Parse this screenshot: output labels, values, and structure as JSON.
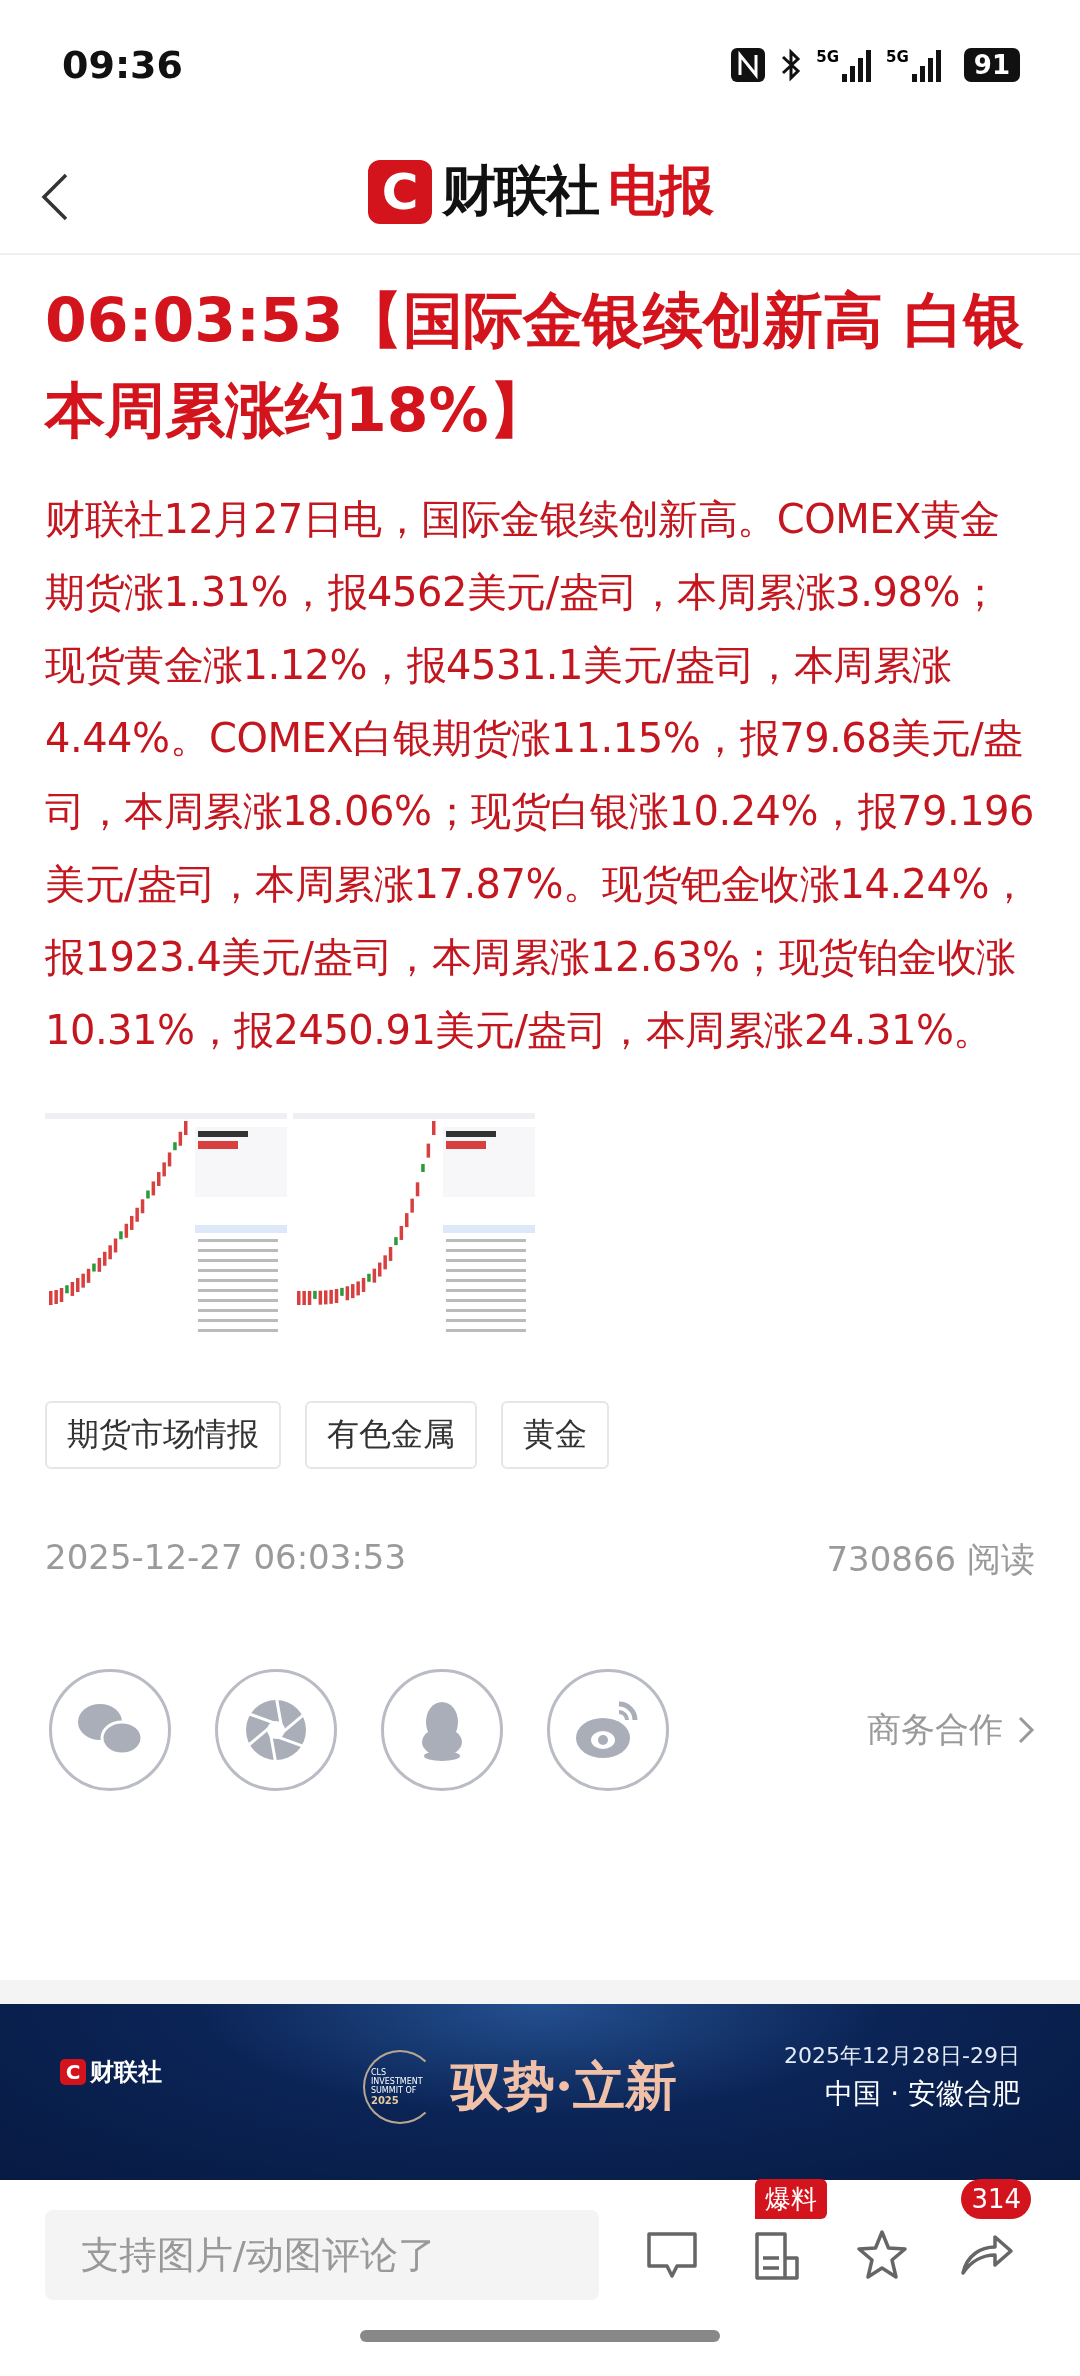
{
  "status_bar": {
    "time": "09:36",
    "networks": [
      "5G",
      "5G"
    ],
    "battery": "91"
  },
  "header": {
    "logo_letter": "C",
    "logo_name": "财联社",
    "logo_accent": "电报"
  },
  "article": {
    "title": "06:03:53【国际金银续创新高 白银本周累涨约18%】",
    "body": "财联社12月27日电，国际金银续创新高。COMEX黄金期货涨1.31%，报4562美元/盎司，本周累涨3.98%；现货黄金涨1.12%，报4531.1美元/盎司，本周累涨4.44%。COMEX白银期货涨11.15%，报79.68美元/盎司，本周累涨18.06%；现货白银涨10.24%，报79.196美元/盎司，本周累涨17.87%。现货钯金收涨14.24%，报1923.4美元/盎司，本周累涨12.63%；现货铂金收涨10.31%，报2450.91美元/盎司，本周累涨24.31%。",
    "images": [
      {
        "kind": "picture"
      },
      {
        "kind": "picture"
      }
    ],
    "tags": [
      "期货市场情报",
      "有色金属",
      "黄金"
    ],
    "timestamp": "2025-12-27 06:03:53",
    "reads": "730866 阅读"
  },
  "share": {
    "targets": [
      {
        "kind": "wechat"
      },
      {
        "kind": "moments"
      },
      {
        "kind": "qq"
      },
      {
        "kind": "weibo"
      }
    ],
    "business_link": "商务合作"
  },
  "banner": {
    "logo_letter": "C",
    "logo_name": "财联社",
    "summit_label": "CLS INVESTMENT SUMMIT OF",
    "summit_year": "2025",
    "slogan": "驭势·立新",
    "date": "2025年12月28日-29日",
    "place": "中国 · 安徽合肥"
  },
  "comment_bar": {
    "placeholder": "支持图片/动图评论了",
    "actions": [
      {
        "kind": "comment"
      },
      {
        "kind": "tip",
        "badge": "爆料"
      },
      {
        "kind": "favorite"
      },
      {
        "kind": "share",
        "badge": "314"
      }
    ]
  }
}
